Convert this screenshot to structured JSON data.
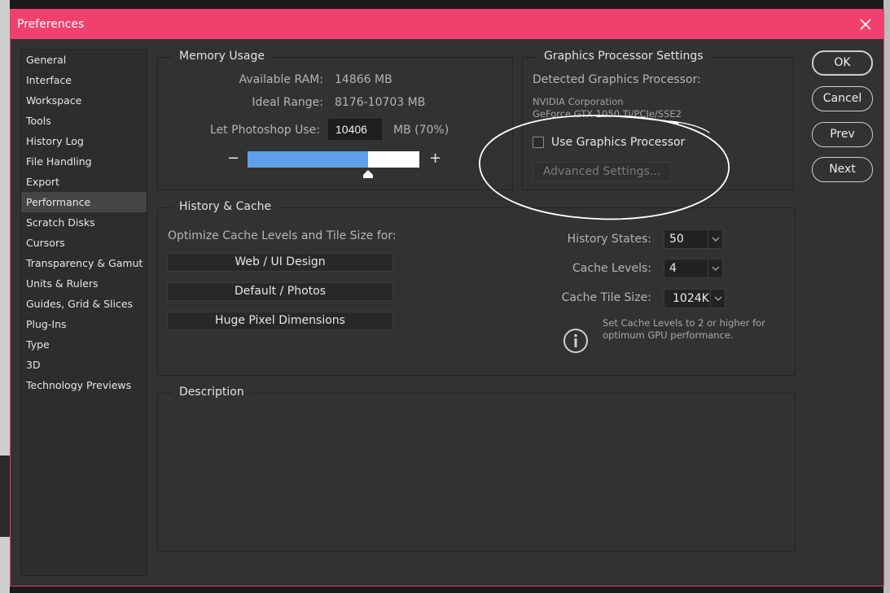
{
  "window": {
    "title": "Preferences"
  },
  "nav": {
    "items": [
      {
        "label": "General"
      },
      {
        "label": "Interface"
      },
      {
        "label": "Workspace"
      },
      {
        "label": "Tools"
      },
      {
        "label": "History Log"
      },
      {
        "label": "File Handling"
      },
      {
        "label": "Export"
      },
      {
        "label": "Performance",
        "active": true
      },
      {
        "label": "Scratch Disks"
      },
      {
        "label": "Cursors"
      },
      {
        "label": "Transparency & Gamut"
      },
      {
        "label": "Units & Rulers"
      },
      {
        "label": "Guides, Grid & Slices"
      },
      {
        "label": "Plug-Ins"
      },
      {
        "label": "Type"
      },
      {
        "label": "3D"
      },
      {
        "label": "Technology Previews"
      }
    ]
  },
  "memory": {
    "title": "Memory Usage",
    "available_label": "Available RAM:",
    "available_value": "14866 MB",
    "ideal_label": "Ideal Range:",
    "ideal_value": "8176-10703 MB",
    "use_label": "Let Photoshop Use:",
    "use_value": "10406",
    "use_unit": "MB (70%)",
    "percent": 70,
    "minus": "−",
    "plus": "+"
  },
  "gpu": {
    "title": "Graphics Processor Settings",
    "detected_label": "Detected Graphics Processor:",
    "vendor": "NVIDIA Corporation",
    "model": "GeForce GTX 1050 Ti/PCIe/SSE2",
    "use_label": "Use Graphics Processor",
    "use_checked": false,
    "advanced_label": "Advanced Settings..."
  },
  "history": {
    "title": "History & Cache",
    "optimize_label": "Optimize Cache Levels and Tile Size for:",
    "presets": [
      "Web / UI Design",
      "Default / Photos",
      "Huge Pixel Dimensions"
    ],
    "states_label": "History States:",
    "states_value": "50",
    "levels_label": "Cache Levels:",
    "levels_value": "4",
    "tile_label": "Cache Tile Size:",
    "tile_value": "1024K",
    "info_line1": "Set Cache Levels to 2 or higher for",
    "info_line2": "optimum GPU performance."
  },
  "description": {
    "title": "Description"
  },
  "buttons": {
    "ok": "OK",
    "cancel": "Cancel",
    "prev": "Prev",
    "next": "Next"
  },
  "colors": {
    "titlebar": "#f0416e",
    "slider_fill": "#5e9eea",
    "panel": "#323232"
  }
}
